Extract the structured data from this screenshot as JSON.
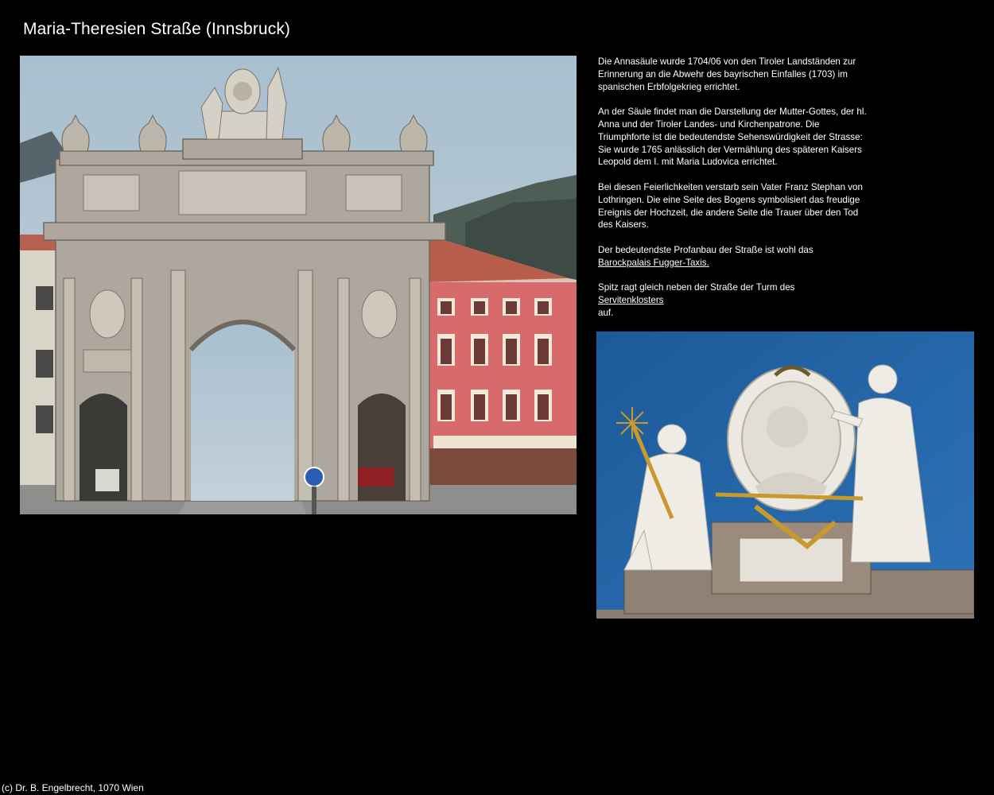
{
  "page": {
    "title": "Maria-Theresien Straße (Innsbruck)",
    "footer": "(c) Dr. B. Engelbrecht, 1070 Wien"
  },
  "text": {
    "p1": "Die Annasäule wurde 1704/06 von den Tiroler Landständen zur Erinnerung an die Abwehr des bayrischen Einfalles (1703) im spanischen Erbfolgekrieg errichtet.",
    "p2": "An der Säule findet man die Darstellung der Mutter-Gottes, der hl. Anna und der Tiroler Landes- und Kirchenpatrone.",
    "p3": "Die Triumphforte ist die bedeutendste Sehenswürdigkeit der Strasse: Sie wurde 1765 anlässlich der Vermählung des späteren Kaisers Leopold dem I. mit Maria Ludovica errichtet.",
    "p4": "Bei diesen Feierlichkeiten verstarb sein Vater Franz Stephan von Lothringen. Die eine Seite des Bogens symbolisiert das freudige Ereignis der Hochzeit, die andere Seite die Trauer über den Tod des Kaisers.",
    "p5_prefix": "Der bedeutendste Profanbau der Straße ist wohl das",
    "p5_link": "Barockpalais Fugger-Taxis.",
    "p6_prefix": "Spitz ragt gleich neben der Straße der Turm des",
    "p6_link": "Servitenklosters",
    "p6_suffix": "auf."
  },
  "images": {
    "arch_icon": "triumphal-arch-photo",
    "statue_icon": "statue-group-photo"
  },
  "colors": {
    "background": "#000000",
    "text": "#ffffff",
    "sky": "#9fb4c4",
    "statue_sky": "#2466a6"
  }
}
